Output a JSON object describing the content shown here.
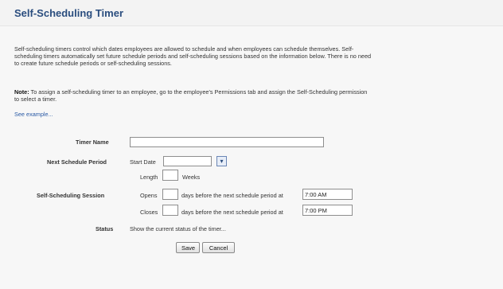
{
  "page": {
    "title": "Self-Scheduling Timer"
  },
  "intro": {
    "description": "Self-scheduling timers control which dates employees are allowed to schedule and when employees can schedule themselves. Self-scheduling timers automatically set future schedule periods and self-scheduling sessions based on the information below. There is no need to create future schedule periods or self-scheduling sessions.",
    "note_label": "Note:",
    "note_text": " To assign a self-scheduling timer to an employee, go to the employee's Permissions tab and assign the Self-Scheduling permission to select a timer.",
    "see_example_link": "See example..."
  },
  "form": {
    "timer_name_label": "Timer Name",
    "timer_name_value": "",
    "next_schedule_period_label": "Next Schedule Period",
    "start_date_label": "Start Date",
    "start_date_value": "",
    "length_label": "Length",
    "length_value": "",
    "weeks_label": "Weeks",
    "session_label": "Self-Scheduling Session",
    "opens_label": "Opens",
    "opens_days_value": "",
    "opens_suffix": "days before the next schedule period at",
    "opens_time_value": "7:00 AM",
    "closes_label": "Closes",
    "closes_days_value": "",
    "closes_suffix": "days before the next schedule period at",
    "closes_time_value": "7:00 PM",
    "status_label": "Status",
    "status_link": "Show the current status of the timer..."
  },
  "actions": {
    "save_label": "Save",
    "cancel_label": "Cancel"
  },
  "icons": {
    "calendar": "calendar-icon"
  },
  "colors": {
    "title": "#2a4d7e",
    "link": "#2a5aa5"
  }
}
